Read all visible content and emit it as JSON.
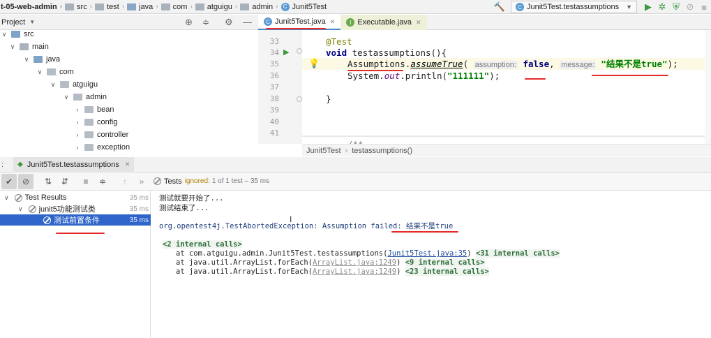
{
  "navbar": {
    "crumbs": [
      {
        "label": "t-05-web-admin",
        "icon": "module"
      },
      {
        "label": "src",
        "icon": "folder"
      },
      {
        "label": "test",
        "icon": "folder"
      },
      {
        "label": "java",
        "icon": "folder"
      },
      {
        "label": "com",
        "icon": "folder"
      },
      {
        "label": "atguigu",
        "icon": "folder"
      },
      {
        "label": "admin",
        "icon": "folder"
      },
      {
        "label": "Junit5Test",
        "icon": "class"
      }
    ],
    "run_config": "Junit5Test.testassumptions"
  },
  "project": {
    "title": "Project",
    "tree": [
      {
        "label": "src",
        "depth": 0,
        "expanded": true
      },
      {
        "label": "main",
        "depth": 1,
        "expanded": true
      },
      {
        "label": "java",
        "depth": 2,
        "expanded": true
      },
      {
        "label": "com",
        "depth": 3,
        "expanded": true
      },
      {
        "label": "atguigu",
        "depth": 4,
        "expanded": true
      },
      {
        "label": "admin",
        "depth": 5,
        "expanded": true
      },
      {
        "label": "bean",
        "depth": 6,
        "expanded": false
      },
      {
        "label": "config",
        "depth": 6,
        "expanded": false
      },
      {
        "label": "controller",
        "depth": 6,
        "expanded": false
      },
      {
        "label": "exception",
        "depth": 6,
        "expanded": false
      }
    ]
  },
  "editor": {
    "tabs": [
      {
        "label": "Junit5Test.java",
        "active": true
      },
      {
        "label": "Executable.java",
        "active": false
      }
    ],
    "line_numbers": [
      "33",
      "34",
      "35",
      "36",
      "37",
      "38",
      "39",
      "40",
      "41"
    ],
    "code": {
      "annotation": "@Test",
      "void_kw": "void",
      "method_decl": " testassumptions(){",
      "assumptions": "Assumptions.",
      "assume_true": "assumeTrue",
      "paren_open": "( ",
      "hint_assumption": "assumption:",
      "false_kw": "false",
      "comma": ", ",
      "hint_message": "message:",
      "message_str": "\"结果不是true\"",
      "line35_end": ");",
      "println_prefix": "System.",
      "println_out": "out",
      "println_mid": ".println(",
      "println_str": "\"111111\"",
      "println_end": ");",
      "closing_brace": "}",
      "doc_start": "/**"
    },
    "breadcrumb": [
      "Junit5Test",
      "testassumptions()"
    ]
  },
  "run": {
    "tab_label": "Junit5Test.testassumptions",
    "status_prefix": "Tests",
    "status_ignored": "ignored:",
    "status_rest": "1 of 1 test – 35 ms",
    "tree": [
      {
        "label": "Test Results",
        "duration": "35 ms",
        "depth": 0,
        "selected": false
      },
      {
        "label": "junit5功能测试类",
        "duration": "35 ms",
        "depth": 1,
        "selected": false
      },
      {
        "label": "测试前置条件",
        "duration": "35 ms",
        "depth": 2,
        "selected": true
      }
    ],
    "console": {
      "line1": "测试就要开始了...",
      "line2": "测试结束了...",
      "exception_prefix": "org.opentest4j.TestAbortedException: Assumption failed: ",
      "exception_msg": "结果不是true",
      "internal_calls": "<2 internal calls>",
      "trace": [
        {
          "prefix": "at com.atguigu.admin.Junit5Test.testassumptions(",
          "link": "Junit5Test.java:35",
          "suffix": ") ",
          "calls": "<31 internal calls>",
          "grey": false
        },
        {
          "prefix": "at java.util.ArrayList.forEach(",
          "link": "ArrayList.java:1249",
          "suffix": ") ",
          "calls": "<9 internal calls>",
          "grey": true
        },
        {
          "prefix": "at java.util.ArrayList.forEach(",
          "link": "ArrayList.java:1249",
          "suffix": ") ",
          "calls": "<23 internal calls>",
          "grey": true
        }
      ]
    }
  },
  "colors": {
    "accent": "#2f65ca",
    "annotation_underline": "#e52a2a",
    "tab_active_border": "#4a88c7"
  }
}
